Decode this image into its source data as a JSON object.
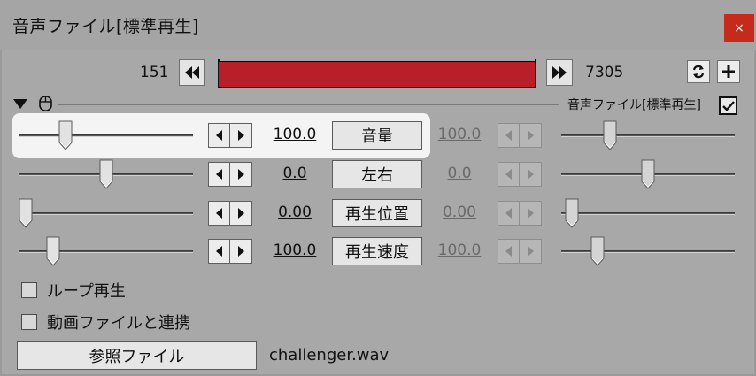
{
  "window": {
    "title": "音声ファイル[標準再生]",
    "close_glyph": "×"
  },
  "timeline": {
    "start_frame": "151",
    "end_frame": "7305",
    "track_color": "#b91f28"
  },
  "group": {
    "label": "音声ファイル[標準再生]",
    "checked": true
  },
  "params": [
    {
      "name": "音量",
      "value": "100.0",
      "end_value": "100.0",
      "position": 0.25,
      "end_position": 0.25
    },
    {
      "name": "左右",
      "value": "0.0",
      "end_value": "0.0",
      "position": 0.5,
      "end_position": 0.5
    },
    {
      "name": "再生位置",
      "value": "0.00",
      "end_value": "0.00",
      "position": 0.0,
      "end_position": 0.0
    },
    {
      "name": "再生速度",
      "value": "100.0",
      "end_value": "100.0",
      "position": 0.17,
      "end_position": 0.17
    }
  ],
  "options": {
    "loop_label": "ループ再生",
    "loop_checked": false,
    "link_label": "動画ファイルと連携",
    "link_checked": false
  },
  "reference": {
    "button_label": "参照ファイル",
    "file_name": "challenger.wav"
  }
}
